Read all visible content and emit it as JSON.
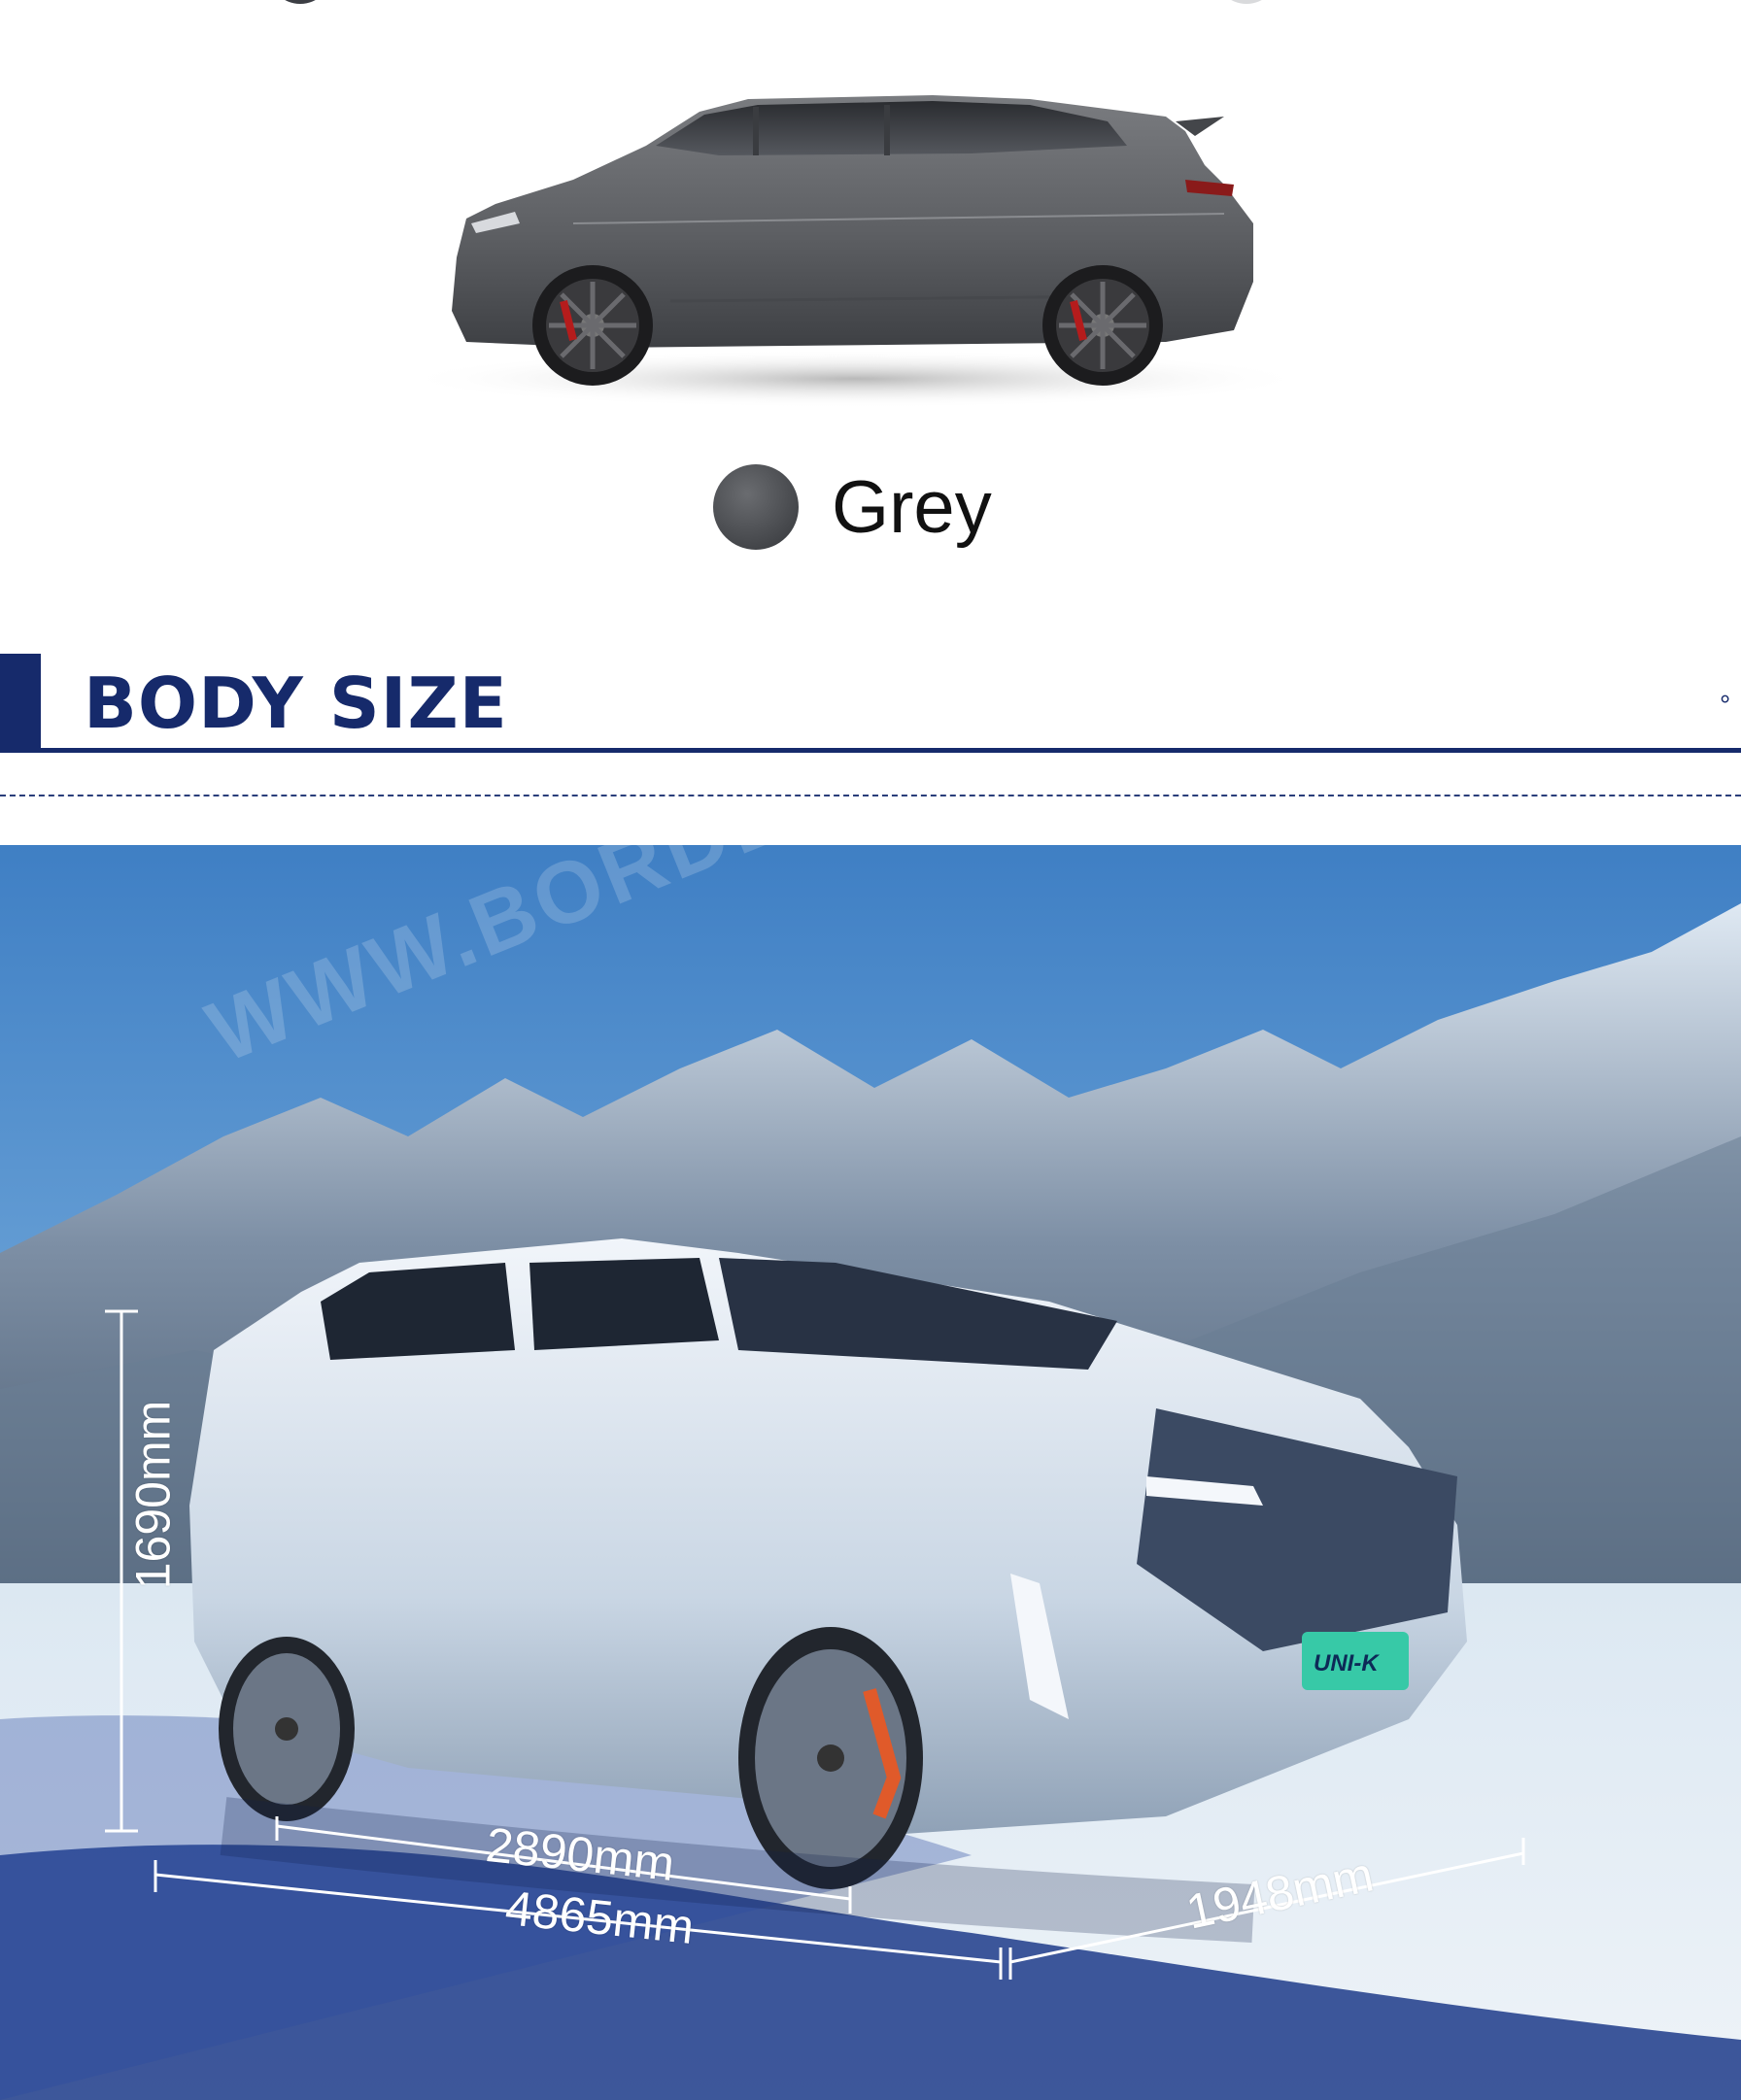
{
  "colors": {
    "accent": "#162a6b",
    "swatch_grey": "#4a4c50",
    "top_chip_left": "#3c3e44",
    "top_chip_right": "#d9dadc"
  },
  "color_option": {
    "label": "Grey",
    "swatch_color": "#4a4c50"
  },
  "section": {
    "title": "BODY SIZE",
    "marker": "°"
  },
  "dimensions": {
    "height": "1690mm",
    "wheelbase": "2890mm",
    "length": "4865mm",
    "width": "1948mm"
  },
  "watermark": "WWW.BORDERLESSCAR.COM",
  "badge": {
    "text": "UNI-K"
  }
}
